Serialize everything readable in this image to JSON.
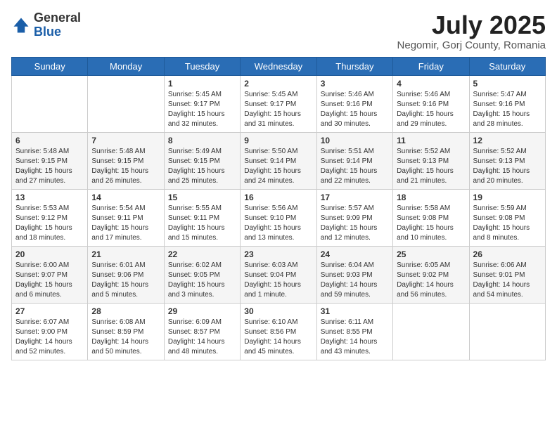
{
  "header": {
    "logo_general": "General",
    "logo_blue": "Blue",
    "month_year": "July 2025",
    "location": "Negomir, Gorj County, Romania"
  },
  "weekdays": [
    "Sunday",
    "Monday",
    "Tuesday",
    "Wednesday",
    "Thursday",
    "Friday",
    "Saturday"
  ],
  "weeks": [
    [
      {
        "day": "",
        "content": ""
      },
      {
        "day": "",
        "content": ""
      },
      {
        "day": "1",
        "content": "Sunrise: 5:45 AM\nSunset: 9:17 PM\nDaylight: 15 hours\nand 32 minutes."
      },
      {
        "day": "2",
        "content": "Sunrise: 5:45 AM\nSunset: 9:17 PM\nDaylight: 15 hours\nand 31 minutes."
      },
      {
        "day": "3",
        "content": "Sunrise: 5:46 AM\nSunset: 9:16 PM\nDaylight: 15 hours\nand 30 minutes."
      },
      {
        "day": "4",
        "content": "Sunrise: 5:46 AM\nSunset: 9:16 PM\nDaylight: 15 hours\nand 29 minutes."
      },
      {
        "day": "5",
        "content": "Sunrise: 5:47 AM\nSunset: 9:16 PM\nDaylight: 15 hours\nand 28 minutes."
      }
    ],
    [
      {
        "day": "6",
        "content": "Sunrise: 5:48 AM\nSunset: 9:15 PM\nDaylight: 15 hours\nand 27 minutes."
      },
      {
        "day": "7",
        "content": "Sunrise: 5:48 AM\nSunset: 9:15 PM\nDaylight: 15 hours\nand 26 minutes."
      },
      {
        "day": "8",
        "content": "Sunrise: 5:49 AM\nSunset: 9:15 PM\nDaylight: 15 hours\nand 25 minutes."
      },
      {
        "day": "9",
        "content": "Sunrise: 5:50 AM\nSunset: 9:14 PM\nDaylight: 15 hours\nand 24 minutes."
      },
      {
        "day": "10",
        "content": "Sunrise: 5:51 AM\nSunset: 9:14 PM\nDaylight: 15 hours\nand 22 minutes."
      },
      {
        "day": "11",
        "content": "Sunrise: 5:52 AM\nSunset: 9:13 PM\nDaylight: 15 hours\nand 21 minutes."
      },
      {
        "day": "12",
        "content": "Sunrise: 5:52 AM\nSunset: 9:13 PM\nDaylight: 15 hours\nand 20 minutes."
      }
    ],
    [
      {
        "day": "13",
        "content": "Sunrise: 5:53 AM\nSunset: 9:12 PM\nDaylight: 15 hours\nand 18 minutes."
      },
      {
        "day": "14",
        "content": "Sunrise: 5:54 AM\nSunset: 9:11 PM\nDaylight: 15 hours\nand 17 minutes."
      },
      {
        "day": "15",
        "content": "Sunrise: 5:55 AM\nSunset: 9:11 PM\nDaylight: 15 hours\nand 15 minutes."
      },
      {
        "day": "16",
        "content": "Sunrise: 5:56 AM\nSunset: 9:10 PM\nDaylight: 15 hours\nand 13 minutes."
      },
      {
        "day": "17",
        "content": "Sunrise: 5:57 AM\nSunset: 9:09 PM\nDaylight: 15 hours\nand 12 minutes."
      },
      {
        "day": "18",
        "content": "Sunrise: 5:58 AM\nSunset: 9:08 PM\nDaylight: 15 hours\nand 10 minutes."
      },
      {
        "day": "19",
        "content": "Sunrise: 5:59 AM\nSunset: 9:08 PM\nDaylight: 15 hours\nand 8 minutes."
      }
    ],
    [
      {
        "day": "20",
        "content": "Sunrise: 6:00 AM\nSunset: 9:07 PM\nDaylight: 15 hours\nand 6 minutes."
      },
      {
        "day": "21",
        "content": "Sunrise: 6:01 AM\nSunset: 9:06 PM\nDaylight: 15 hours\nand 5 minutes."
      },
      {
        "day": "22",
        "content": "Sunrise: 6:02 AM\nSunset: 9:05 PM\nDaylight: 15 hours\nand 3 minutes."
      },
      {
        "day": "23",
        "content": "Sunrise: 6:03 AM\nSunset: 9:04 PM\nDaylight: 15 hours\nand 1 minute."
      },
      {
        "day": "24",
        "content": "Sunrise: 6:04 AM\nSunset: 9:03 PM\nDaylight: 14 hours\nand 59 minutes."
      },
      {
        "day": "25",
        "content": "Sunrise: 6:05 AM\nSunset: 9:02 PM\nDaylight: 14 hours\nand 56 minutes."
      },
      {
        "day": "26",
        "content": "Sunrise: 6:06 AM\nSunset: 9:01 PM\nDaylight: 14 hours\nand 54 minutes."
      }
    ],
    [
      {
        "day": "27",
        "content": "Sunrise: 6:07 AM\nSunset: 9:00 PM\nDaylight: 14 hours\nand 52 minutes."
      },
      {
        "day": "28",
        "content": "Sunrise: 6:08 AM\nSunset: 8:59 PM\nDaylight: 14 hours\nand 50 minutes."
      },
      {
        "day": "29",
        "content": "Sunrise: 6:09 AM\nSunset: 8:57 PM\nDaylight: 14 hours\nand 48 minutes."
      },
      {
        "day": "30",
        "content": "Sunrise: 6:10 AM\nSunset: 8:56 PM\nDaylight: 14 hours\nand 45 minutes."
      },
      {
        "day": "31",
        "content": "Sunrise: 6:11 AM\nSunset: 8:55 PM\nDaylight: 14 hours\nand 43 minutes."
      },
      {
        "day": "",
        "content": ""
      },
      {
        "day": "",
        "content": ""
      }
    ]
  ]
}
